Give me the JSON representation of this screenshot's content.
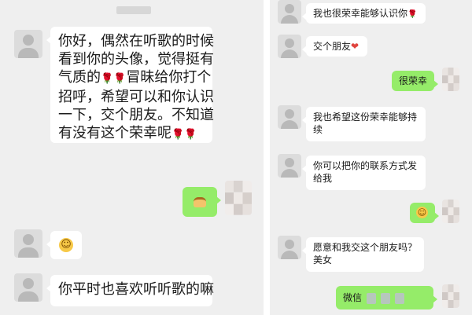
{
  "left_chat": {
    "message1_lines": [
      "你好，偶然在听歌的时候",
      "看到你的头像，觉得挺有",
      "气质的",
      "冒昧给你打个",
      "招呼，希望可以和你认识",
      "一下，交个朋友。不知道",
      "有没有这个荣幸呢"
    ],
    "message2_emoji": "smile-emoji",
    "message3": "你平时也喜欢听听歌的嘛",
    "sent_sticker": "pudding-sticker"
  },
  "right_chat": {
    "msg1": "我也很荣幸能够认识你",
    "msg2": "交个朋友",
    "reply1": "很荣幸",
    "msg3_lines": [
      "我也希望这份荣幸能够持",
      "续"
    ],
    "msg4_lines": [
      "你可以把你的联系方式发",
      "给我"
    ],
    "reply2_emoji": "smile-emoji",
    "msg5_lines": [
      "愿意和我交这个朋友吗？",
      "美女"
    ],
    "reply3": "微信"
  },
  "glyphs": {
    "rose": "🌹",
    "heart": "❤",
    "smile": "☺"
  },
  "colors": {
    "sent_bubble": "#95ec69",
    "received_bubble": "#ffffff",
    "chat_background": "#efefef"
  }
}
